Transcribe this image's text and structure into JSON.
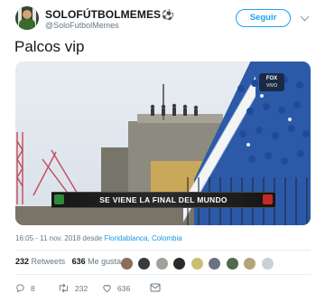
{
  "header": {
    "display_name": "SOLOFÚTBOLMEMES",
    "handle": "@SoloFutbolMemes",
    "follow_label": "Seguir"
  },
  "tweet": {
    "text": "Palcos vip"
  },
  "media": {
    "banner_text": "SE VIENE LA FINAL DEL MUNDO",
    "logo_text": "FOX",
    "logo_subtext": "VIVO"
  },
  "meta": {
    "timestamp": "16:05 - 11 nov. 2018 desde",
    "location": "Floridablanca, Colombia"
  },
  "stats": {
    "retweets_count": "232",
    "retweets_label": "Retweets",
    "likes_count": "636",
    "likes_label": "Me gusta"
  },
  "actions": {
    "reply_count": "8",
    "retweet_count": "232",
    "like_count": "636"
  },
  "colors": {
    "accent": "#1da1f2",
    "muted": "#657786",
    "link": "#1b95e0"
  },
  "icons": [
    "soccer-ball-icon",
    "chevron-down-icon",
    "reply-icon",
    "retweet-icon",
    "like-icon",
    "message-icon"
  ]
}
